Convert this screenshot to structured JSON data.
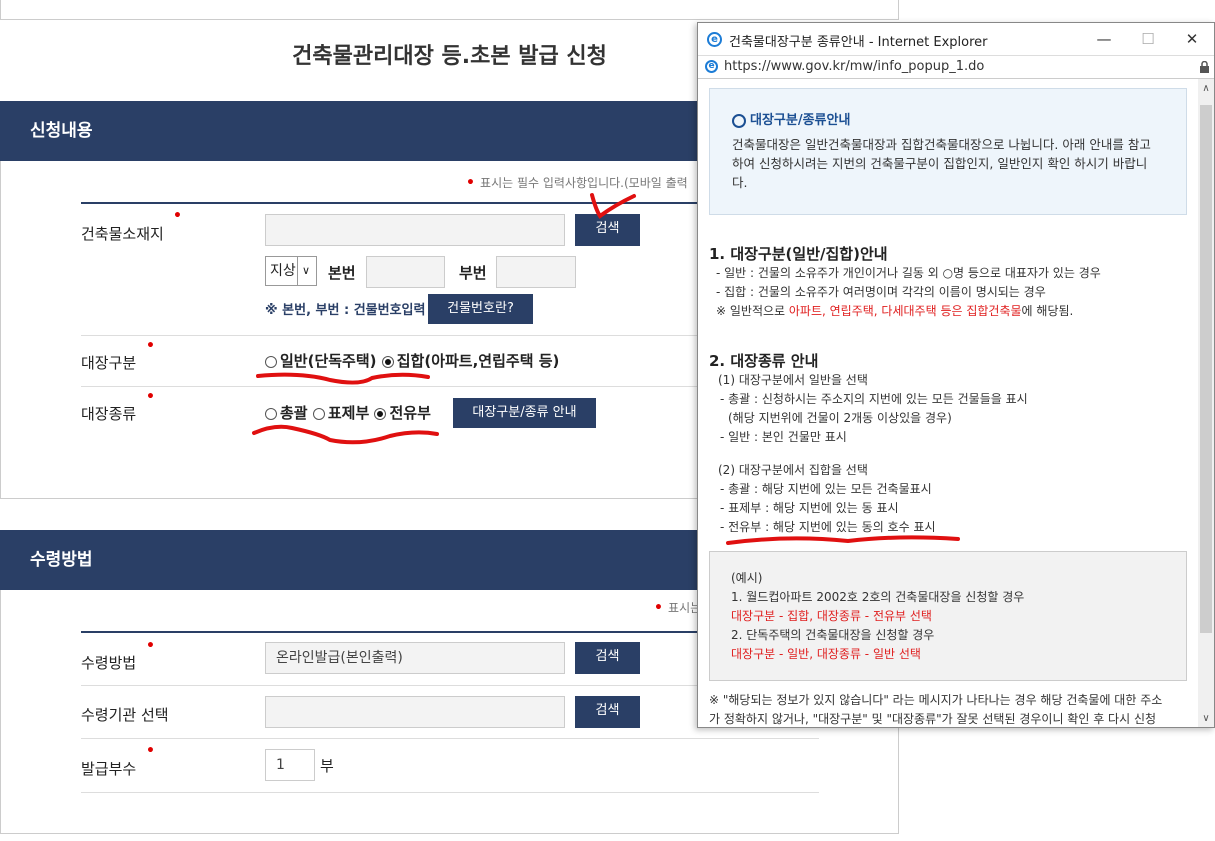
{
  "page": {
    "title": "건축물관리대장 등.초본 발급 신청"
  },
  "section1": {
    "header": "신청내용",
    "required_note": "표시는 필수 입력사항입니다.(모바일 출력",
    "location": {
      "label": "건축물소재지",
      "search_button": "검색",
      "select_value": "지상",
      "select_arrow": "∨",
      "bonbeon_label": "본번",
      "bubeon_label": "부번",
      "hint": "※ 본번, 부번 : 건물번호입력",
      "building_no_button": "건물번호란?"
    },
    "ledger_type": {
      "label": "대장구분",
      "option1": "일반(단독주택)",
      "option2": "집합(아파트,연립주택 등)",
      "selected": "집합(아파트,연립주택 등)"
    },
    "ledger_kind": {
      "label": "대장종류",
      "option1": "총괄",
      "option2": "표제부",
      "option3": "전유부",
      "selected": "전유부",
      "guide_button": "대장구분/종류 안내"
    }
  },
  "section2": {
    "header": "수령방법",
    "required_note": "표시는",
    "receive_method": {
      "label": "수령방법",
      "value": "온라인발급(본인출력)",
      "search_button": "검색"
    },
    "receive_org": {
      "label": "수령기관 선택",
      "value": "",
      "search_button": "검색"
    },
    "copies": {
      "label": "발급부수",
      "value": "1",
      "unit": "부"
    }
  },
  "popup": {
    "window_title": "건축물대장구분 종류안내 - Internet Explorer",
    "url": "https://www.gov.kr/mw/info_popup_1.do",
    "minimize": "—",
    "maximize": "☐",
    "close": "✕",
    "info_title": "대장구분/종류안내",
    "info_lines": [
      "건축물대장은 일반건축물대장과 집합건축물대장으로 나뉩니다. 아래 안내를 참고",
      "하여 신청하시려는 지번의 건축물구분이 집합인지, 일반인지 확인 하시기 바랍니",
      "다."
    ],
    "h1": "1. 대장구분(일반/집합)안내",
    "s1_lines": [
      "- 일반 : 건물의 소유주가 개인이거나 길동 외 ○명 등으로 대표자가 있는 경우",
      "- 집합 : 건물의 소유주가 여러명이며 각각의 이름이 명시되는 경우"
    ],
    "s1_note_prefix": "※ 일반적으로 ",
    "s1_note_red": "아파트, 연립주택, 다세대주택 등은 집합건축물",
    "s1_note_suffix": "에 해당됨.",
    "h2": "2. 대장종류 안내",
    "s2_lines": [
      "(1) 대장구분에서 일반을 선택",
      "- 총괄 : 신청하시는 주소지의 지번에 있는 모든 건물들을 표시",
      "(해당 지번위에 건물이 2개동 이상있을 경우)",
      "- 일반 : 본인 건물만 표시",
      "(2) 대장구분에서 집합을 선택",
      "- 총괄 : 해당 지번에 있는 모든 건축물표시",
      "- 표제부 : 해당 지번에 있는 동 표시",
      "- 전유부 : 해당 지번에 있는 동의 호수 표시"
    ],
    "example": {
      "title": "(예시)",
      "line1": "1. 월드컵아파트 2002호 2호의 건축물대장을 신청할 경우",
      "line1_red": "대장구분 - 집합, 대장종류 - 전유부 선택",
      "line2": "2. 단독주택의 건축물대장을 신청할 경우",
      "line2_red": "대장구분 - 일반, 대장종류 - 일반 선택"
    },
    "footer_lines": [
      "※ \"해당되는 정보가 있지 않습니다\" 라는 메시지가 나타나는 경우 해당 건축물에 대한 주소",
      "가 정확하지 않거나, \"대장구분\" 및 \"대장종류\"가 잘못 선택된 경우이니 확인 후 다시 신청"
    ],
    "scroll_up": "∧",
    "scroll_down": "∨"
  },
  "colors": {
    "navy": "#2a3f66",
    "required_red": "#e00000",
    "annotation_red": "#e01010"
  }
}
